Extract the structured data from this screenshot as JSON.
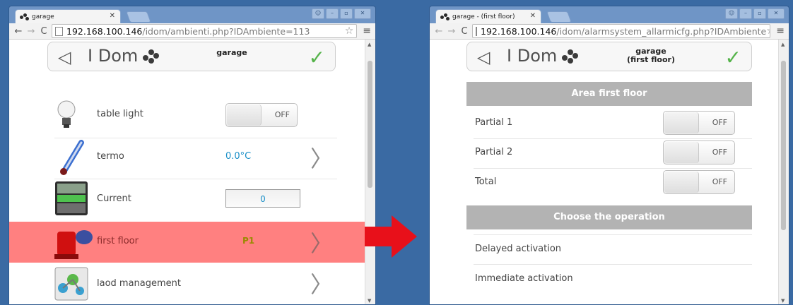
{
  "left": {
    "tab_title": "garage",
    "url_host": "192.168.100.146",
    "url_path": "/idom/ambienti.php?IDAmbiente=113",
    "header": {
      "logo_text": "I Dom",
      "title": "garage"
    },
    "rows": [
      {
        "label": "table light",
        "icon": "lightbulb-icon",
        "toggle_text": "OFF"
      },
      {
        "label": "termo",
        "icon": "thermometer-icon",
        "value": "0.0°C"
      },
      {
        "label": "Current",
        "icon": "level-gauge-icon",
        "value": "0"
      },
      {
        "label": "first floor",
        "icon": "alarm-siren-icon",
        "value": "P1"
      },
      {
        "label": "laod management",
        "icon": "molecule-icon"
      }
    ],
    "highlight_color": "#ff8080"
  },
  "right": {
    "tab_title": "garage - (first floor)",
    "url_host": "192.168.100.146",
    "url_path": "/idom/alarmsystem_allarmicfg.php?IDAmbiente",
    "header": {
      "logo_text": "I Dom",
      "title_line1": "garage",
      "title_line2": "(first floor)"
    },
    "section1": "Area first floor",
    "partials": [
      {
        "label": "Partial 1",
        "toggle_text": "OFF"
      },
      {
        "label": "Partial 2",
        "toggle_text": "OFF"
      },
      {
        "label": "Total",
        "toggle_text": "OFF"
      }
    ],
    "section2": "Choose the operation",
    "operations": [
      "Delayed activation",
      "Immediate activation"
    ]
  },
  "colors": {
    "arrow": "#e8101a",
    "desktop": "#3a6aa3",
    "check": "#55b34a"
  }
}
